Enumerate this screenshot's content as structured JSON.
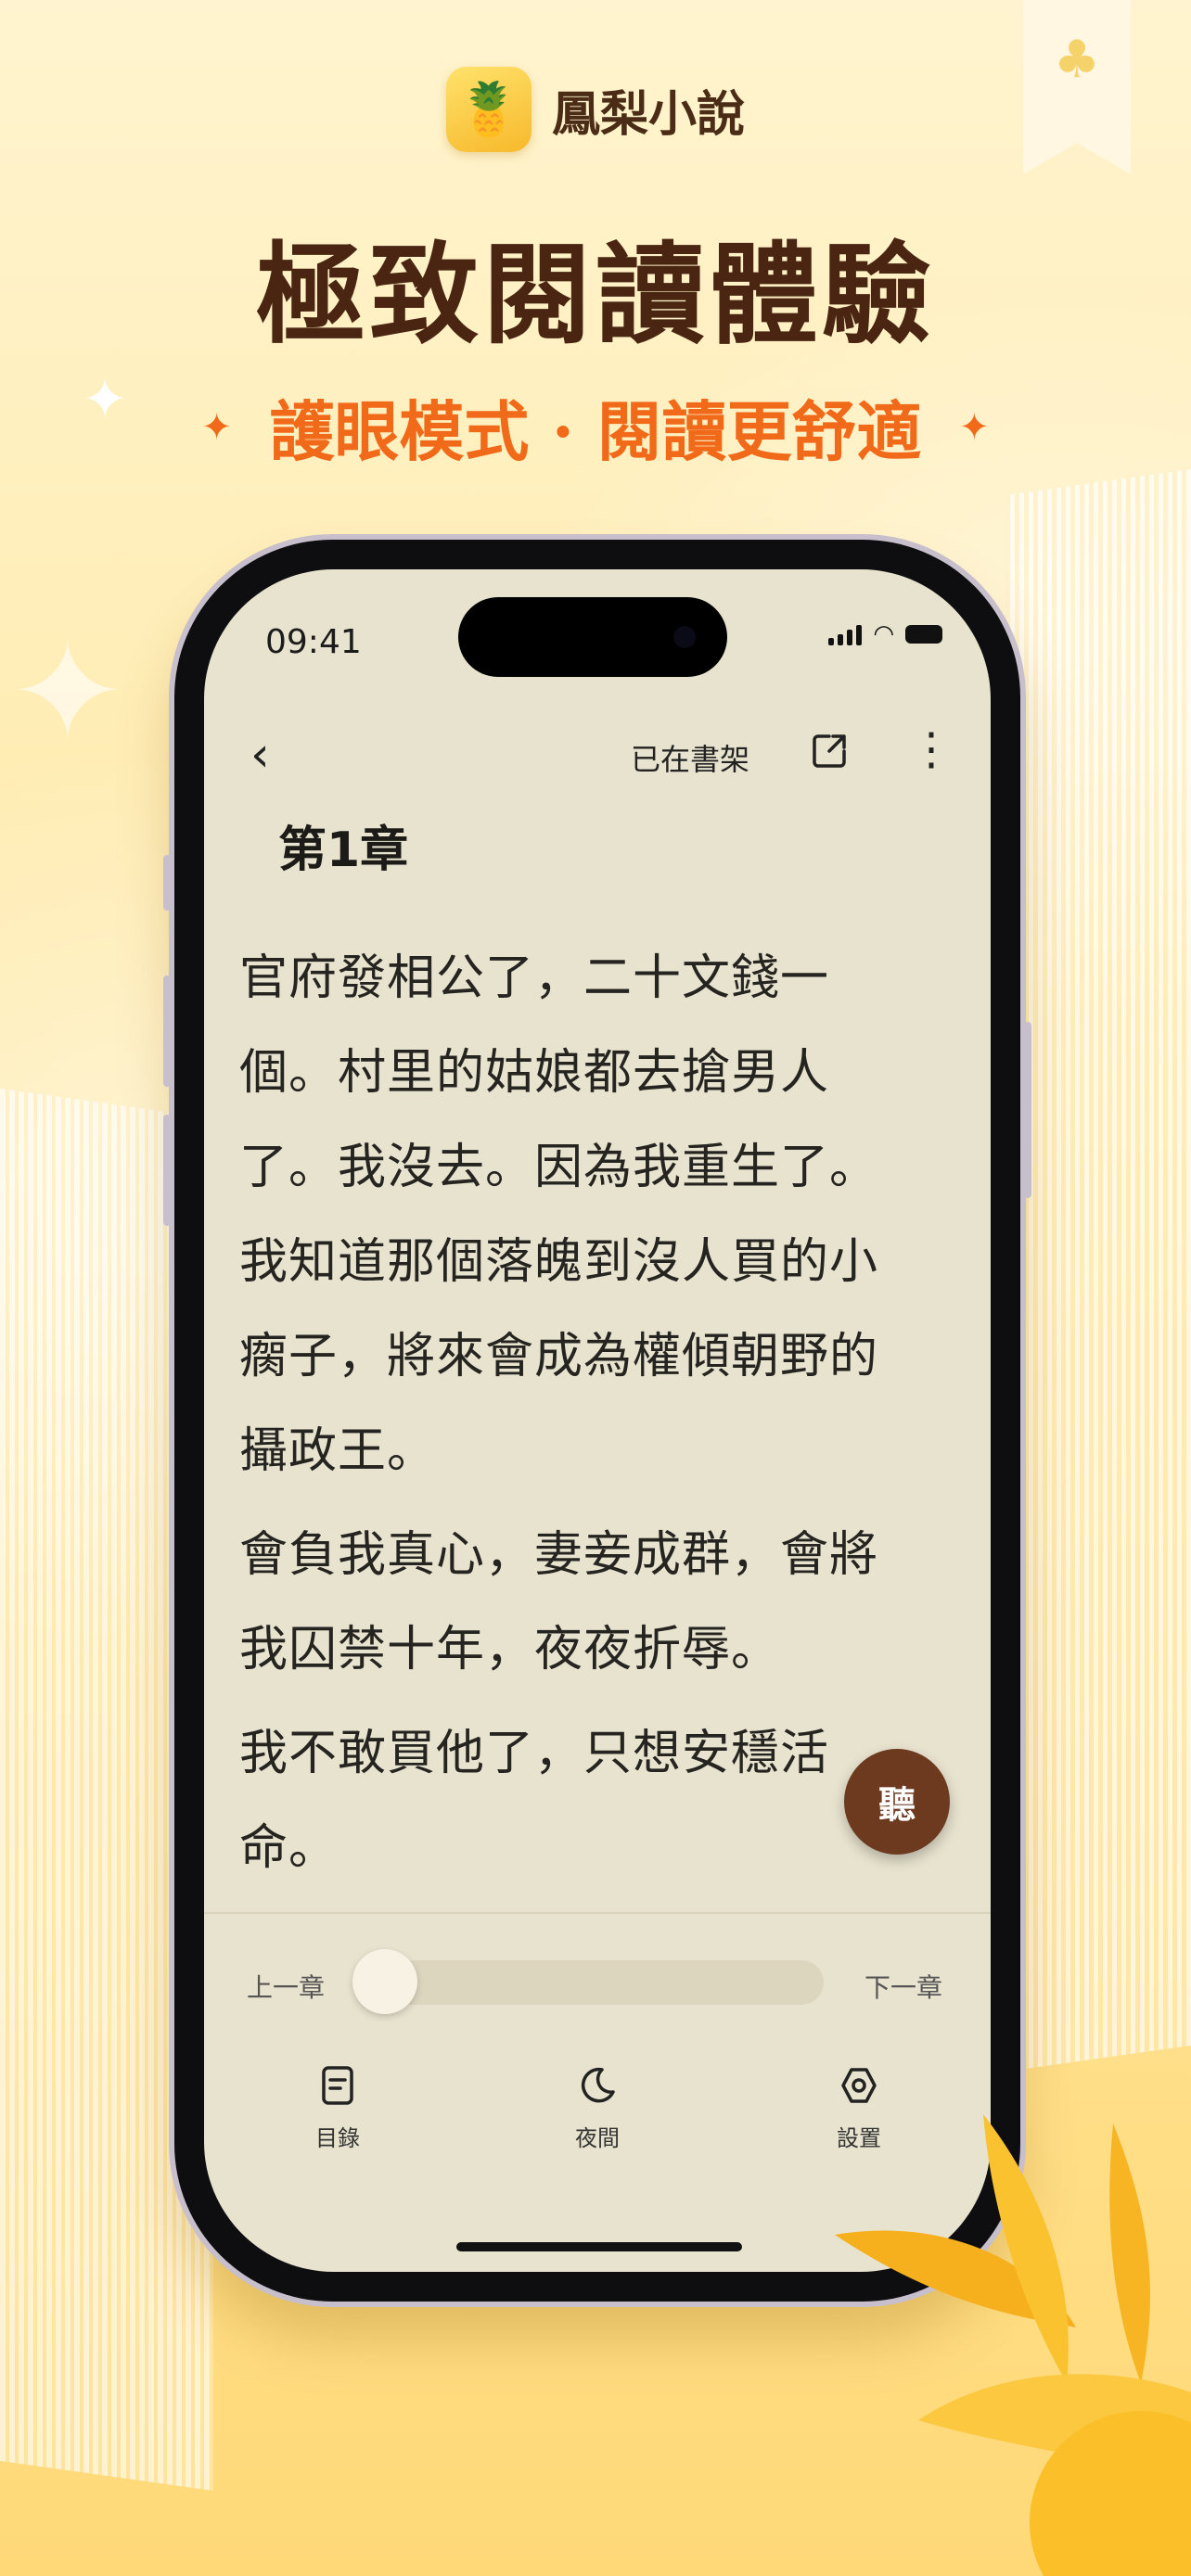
{
  "brand": {
    "name": "鳳梨小說",
    "icon": "pineapple-icon"
  },
  "headline": "極致閱讀體驗",
  "subline": "護眼模式 · 閱讀更舒適",
  "status_bar": {
    "time": "09:41"
  },
  "reader": {
    "shelf_label": "已在書架",
    "chapter_title": "第1章",
    "paragraphs": [
      "官府發相公了，二十文錢一個。村里的姑娘都去搶男人了。我沒去。因為我重生了。我知道那個落魄到沒人買的小瘸子，將來會成為權傾朝野的攝政王。",
      "會負我真心，妻妾成群，會將我囚禁十年，夜夜折辱。",
      "我不敢買他了，只想安穩活命。"
    ],
    "listen_label": "聽",
    "prev_chapter": "上一章",
    "next_chapter": "下一章",
    "progress": 0.0
  },
  "tabs": [
    {
      "label": "目錄",
      "icon": "toc-icon"
    },
    {
      "label": "夜間",
      "icon": "moon-icon"
    },
    {
      "label": "設置",
      "icon": "settings-icon"
    }
  ],
  "colors": {
    "accent_orange": "#f06a1a",
    "headline_brown": "#4a2612",
    "reader_bg": "#e8e3cf",
    "listen_button": "#6d3a20"
  }
}
